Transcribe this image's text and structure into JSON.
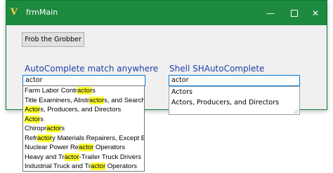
{
  "window": {
    "title": "frmMain",
    "icon": "vb-app-icon",
    "minimize_glyph": "—",
    "close_glyph": "✕"
  },
  "colors": {
    "titlebar": "#1e8a3f",
    "section_label": "#1f3ea8",
    "highlight": "#ffff30",
    "focus_border": "#0078d7"
  },
  "frob_button": {
    "label": "Frob the Grobber"
  },
  "left": {
    "label": "AutoComplete match anywhere",
    "input_value": "actor",
    "suggestions": [
      {
        "pre": "Farm Labor Contr",
        "match": "actor",
        "post": "s"
      },
      {
        "pre": "Title Examiners, Abstr",
        "match": "actor",
        "post": "s, and Searchers"
      },
      {
        "pre": "",
        "match": "Actor",
        "post": "s, Producers, and Directors"
      },
      {
        "pre": "",
        "match": "Actor",
        "post": "s"
      },
      {
        "pre": "Chiropr",
        "match": "actor",
        "post": "s"
      },
      {
        "pre": "Refr",
        "match": "actor",
        "post": "y Materials Repairers, Except Brickma"
      },
      {
        "pre": "Nuclear Power Re",
        "match": "actor",
        "post": " Operators"
      },
      {
        "pre": "Heavy and Tr",
        "match": "actor",
        "post": "-Trailer Truck Drivers"
      },
      {
        "pre": "Industrial Truck and Tr",
        "match": "actor",
        "post": " Operators"
      }
    ]
  },
  "right": {
    "label": "Shell SHAutoComplete",
    "input_value": "actor",
    "suggestions": [
      "Actors",
      "Actors, Producers, and Directors"
    ]
  }
}
